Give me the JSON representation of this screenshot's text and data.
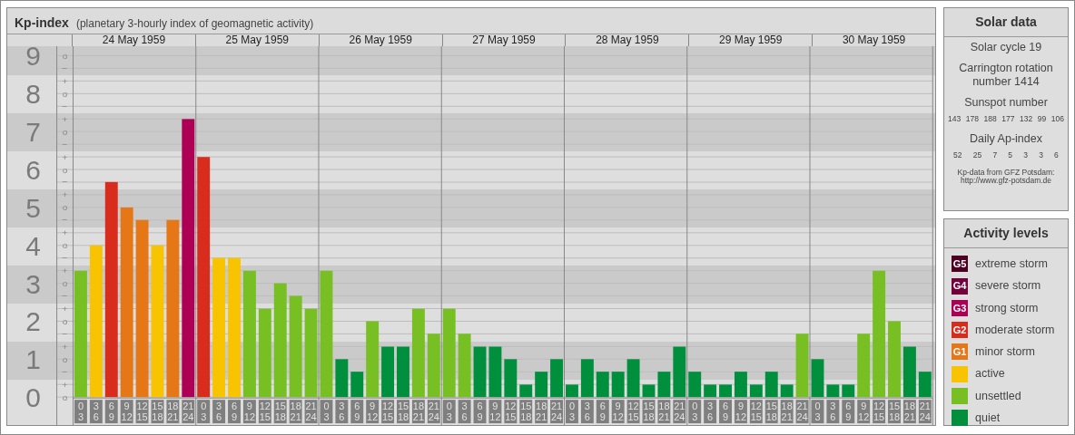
{
  "header": {
    "title": "Kp-index",
    "subtitle": "(planetary 3-hourly index of geomagnetic activity)"
  },
  "chart": {
    "days": [
      "24 May 1959",
      "25 May 1959",
      "26 May 1959",
      "27 May 1959",
      "28 May 1959",
      "29 May 1959",
      "30 May 1959"
    ],
    "scale_marks": [
      "o",
      "−",
      "+",
      "o",
      "−",
      "+",
      "o",
      "−",
      "+",
      "o",
      "−",
      "+",
      "o",
      "−",
      "+",
      "o",
      "−",
      "+",
      "o",
      "−",
      "+",
      "o",
      "−",
      "+",
      "o",
      "−",
      "+",
      "o"
    ],
    "chart_data": {
      "type": "bar",
      "ylim": [
        0,
        9.25
      ],
      "grid": true,
      "categories": [
        "0\n3",
        "3\n6",
        "6\n9",
        "9\n12",
        "12\n15",
        "15\n18",
        "18\n21",
        "21\n24",
        "0\n3",
        "3\n6",
        "6\n9",
        "9\n12",
        "12\n15",
        "15\n18",
        "18\n21",
        "21\n24",
        "0\n3",
        "3\n6",
        "6\n9",
        "9\n12",
        "12\n15",
        "15\n18",
        "18\n21",
        "21\n24",
        "0\n3",
        "3\n6",
        "6\n9",
        "9\n12",
        "12\n15",
        "15\n18",
        "18\n21",
        "21\n24",
        "0\n3",
        "3\n6",
        "6\n9",
        "9\n12",
        "12\n15",
        "15\n18",
        "18\n21",
        "21\n24",
        "0\n3",
        "3\n6",
        "6\n9",
        "9\n12",
        "12\n15",
        "15\n18",
        "18\n21",
        "21\n24",
        "0\n3",
        "3\n6",
        "6\n9",
        "9\n12",
        "12\n15",
        "15\n18",
        "18\n21",
        "21\n24"
      ],
      "yticks": [
        {
          "value": 9,
          "label": "9"
        },
        {
          "value": 8,
          "label": "8"
        },
        {
          "value": 7,
          "label": "7"
        },
        {
          "value": 6,
          "label": "6"
        },
        {
          "value": 5,
          "label": "5"
        },
        {
          "value": 4,
          "label": "4"
        },
        {
          "value": 3,
          "label": "3"
        },
        {
          "value": 2,
          "label": "2"
        },
        {
          "value": 1,
          "label": "1"
        },
        {
          "value": 0,
          "label": "0"
        }
      ],
      "series": [
        {
          "color": "#008f3c",
          "values": [
            null,
            null,
            null,
            null,
            null,
            null,
            null,
            null,
            null,
            null,
            null,
            null,
            null,
            null,
            null,
            null,
            null,
            1,
            0.67,
            null,
            1.33,
            1.33,
            null,
            null,
            null,
            null,
            1.33,
            1.33,
            1,
            0.33,
            0.67,
            1,
            0.33,
            1,
            0.67,
            0.67,
            1,
            0.33,
            0.67,
            1.33,
            0.67,
            0.33,
            0.33,
            0.67,
            0.33,
            0.67,
            0.33,
            null,
            1,
            0.33,
            0.33,
            null,
            null,
            null,
            1.33,
            0.67
          ]
        },
        {
          "color": "#77bf22",
          "values": [
            3.33,
            null,
            null,
            null,
            null,
            null,
            null,
            null,
            null,
            null,
            null,
            3.33,
            2.33,
            3,
            2.67,
            2.33,
            3.33,
            null,
            null,
            2,
            null,
            null,
            2.33,
            1.67,
            2.33,
            1.67,
            null,
            null,
            null,
            null,
            null,
            null,
            null,
            null,
            null,
            null,
            null,
            null,
            null,
            null,
            null,
            null,
            null,
            null,
            null,
            null,
            null,
            1.67,
            null,
            null,
            null,
            1.67,
            3.33,
            2,
            null,
            null
          ]
        },
        {
          "color": "#f8c300",
          "values": [
            null,
            4,
            null,
            null,
            null,
            4,
            null,
            null,
            null,
            3.67,
            3.67,
            null,
            null,
            null,
            null,
            null,
            null,
            null,
            null,
            null,
            null,
            null,
            null,
            null,
            null,
            null,
            null,
            null,
            null,
            null,
            null,
            null,
            null,
            null,
            null,
            null,
            null,
            null,
            null,
            null,
            null,
            null,
            null,
            null,
            null,
            null,
            null,
            null,
            null,
            null,
            null,
            null,
            null,
            null,
            null,
            null
          ]
        },
        {
          "color": "#e57717",
          "values": [
            null,
            null,
            null,
            5,
            4.67,
            null,
            4.67,
            null,
            null,
            null,
            null,
            null,
            null,
            null,
            null,
            null,
            null,
            null,
            null,
            null,
            null,
            null,
            null,
            null,
            null,
            null,
            null,
            null,
            null,
            null,
            null,
            null,
            null,
            null,
            null,
            null,
            null,
            null,
            null,
            null,
            null,
            null,
            null,
            null,
            null,
            null,
            null,
            null,
            null,
            null,
            null,
            null,
            null,
            null,
            null,
            null
          ]
        },
        {
          "color": "#d82c1c",
          "values": [
            null,
            null,
            5.67,
            null,
            null,
            null,
            null,
            null,
            6.33,
            null,
            null,
            null,
            null,
            null,
            null,
            null,
            null,
            null,
            null,
            null,
            null,
            null,
            null,
            null,
            null,
            null,
            null,
            null,
            null,
            null,
            null,
            null,
            null,
            null,
            null,
            null,
            null,
            null,
            null,
            null,
            null,
            null,
            null,
            null,
            null,
            null,
            null,
            null,
            null,
            null,
            null,
            null,
            null,
            null,
            null,
            null
          ]
        },
        {
          "color": "#ad0055",
          "values": [
            null,
            null,
            null,
            null,
            null,
            null,
            null,
            7.33,
            null,
            null,
            null,
            null,
            null,
            null,
            null,
            null,
            null,
            null,
            null,
            null,
            null,
            null,
            null,
            null,
            null,
            null,
            null,
            null,
            null,
            null,
            null,
            null,
            null,
            null,
            null,
            null,
            null,
            null,
            null,
            null,
            null,
            null,
            null,
            null,
            null,
            null,
            null,
            null,
            null,
            null,
            null,
            null,
            null,
            null,
            null,
            null
          ]
        }
      ]
    }
  },
  "solar_data": {
    "title": "Solar data",
    "cycle": "Solar cycle 19",
    "carrington": "Carrington rotation number 1414",
    "sunspot_title": "Sunspot number",
    "sunspot_numbers": [
      "143",
      "178",
      "188",
      "177",
      "132",
      "99",
      "106"
    ],
    "ap_title": "Daily Ap-index",
    "ap_values": [
      "52",
      "25",
      "7",
      "5",
      "3",
      "3",
      "6"
    ],
    "source": "Kp-data from GFZ Potsdam:",
    "source_url": "http://www.gfz-potsdam.de"
  },
  "activity_levels": {
    "title": "Activity levels",
    "items": [
      {
        "code": "G5",
        "label": "extreme storm",
        "color": "#4e0022"
      },
      {
        "code": "G4",
        "label": "severe storm",
        "color": "#74003c"
      },
      {
        "code": "G3",
        "label": "strong storm",
        "color": "#ad0055"
      },
      {
        "code": "G2",
        "label": "moderate storm",
        "color": "#d82c1c"
      },
      {
        "code": "G1",
        "label": "minor storm",
        "color": "#e57717"
      },
      {
        "label": "active",
        "color": "#f8c300"
      },
      {
        "label": "unsettled",
        "color": "#77bf22"
      },
      {
        "label": "quiet",
        "color": "#008f3c"
      }
    ]
  }
}
